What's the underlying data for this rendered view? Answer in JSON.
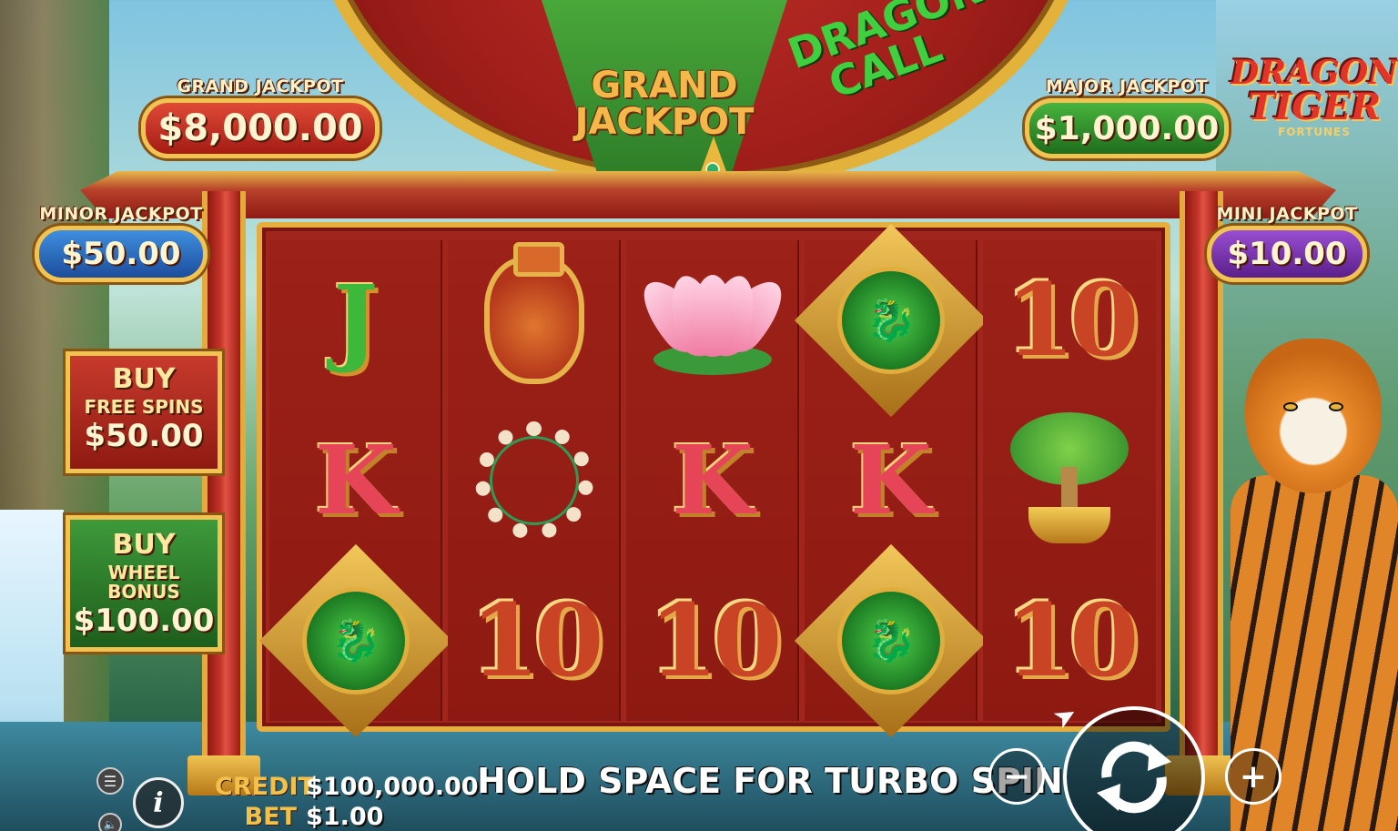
{
  "wheel": {
    "grand_segment": "GRAND JACKPOT",
    "dragon_segment": "DRAGON CALL"
  },
  "jackpots": {
    "grand": {
      "label": "GRAND JACKPOT",
      "value": "$8,000.00"
    },
    "major": {
      "label": "MAJOR JACKPOT",
      "value": "$1,000.00"
    },
    "minor": {
      "label": "MINOR JACKPOT",
      "value": "$50.00"
    },
    "mini": {
      "label": "MINI JACKPOT",
      "value": "$10.00"
    }
  },
  "logo": {
    "line1": "DRAGON",
    "line2": "TIGER",
    "line3": "FORTUNES"
  },
  "buy_free_spins": {
    "line1": "BUY",
    "line2": "FREE SPINS",
    "price": "$50.00"
  },
  "buy_wheel_bonus": {
    "line1": "BUY",
    "line2": "WHEEL BONUS",
    "price": "$100.00"
  },
  "reels": {
    "row1": [
      "J",
      "vase",
      "lotus",
      "jade-dragon-medallion",
      "10"
    ],
    "row2": [
      "K",
      "prayer-beads",
      "K",
      "K",
      "bonsai"
    ],
    "row3": [
      "jade-dragon-medallion",
      "10",
      "10",
      "jade-dragon-medallion",
      "10"
    ],
    "letters": {
      "j": "J",
      "k": "K",
      "ten": "10"
    }
  },
  "bottom_bar": {
    "credit_label": "CREDIT",
    "credit_value": "$100,000.00",
    "bet_label": "BET",
    "bet_value": "$1.00",
    "message": "HOLD SPACE FOR TURBO SPIN",
    "minus": "−",
    "plus": "+",
    "info": "i"
  },
  "colors": {
    "grand": "#b8221a",
    "major": "#2e8a2a",
    "minor": "#2d6fc4",
    "mini": "#7a34b2",
    "gold": "#f0c352",
    "reel_bg": "#9c2118"
  },
  "icons": [
    "menu-icon",
    "sound-icon",
    "info-icon",
    "minus-icon",
    "plus-icon",
    "spin-icon"
  ]
}
